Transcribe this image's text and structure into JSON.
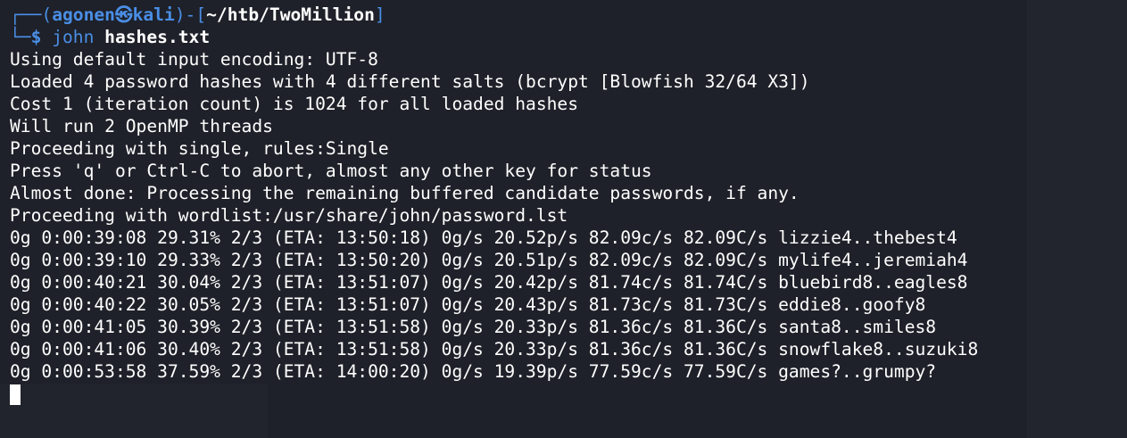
{
  "prompt": {
    "open": "┌──(",
    "user": "agonen",
    "skull": "㉿",
    "host": "kali",
    "mid": ")-[",
    "path": "~/htb/TwoMillion",
    "close": "]",
    "second_line_prefix": "└─",
    "dollar": "$",
    "command": "john",
    "argument": "hashes.txt"
  },
  "output_lines": [
    "Using default input encoding: UTF-8",
    "Loaded 4 password hashes with 4 different salts (bcrypt [Blowfish 32/64 X3])",
    "Cost 1 (iteration count) is 1024 for all loaded hashes",
    "Will run 2 OpenMP threads",
    "Proceeding with single, rules:Single",
    "Press 'q' or Ctrl-C to abort, almost any other key for status",
    "Almost done: Processing the remaining buffered candidate passwords, if any.",
    "Proceeding with wordlist:/usr/share/john/password.lst",
    "0g 0:00:39:08 29.31% 2/3 (ETA: 13:50:18) 0g/s 20.52p/s 82.09c/s 82.09C/s lizzie4..thebest4",
    "0g 0:00:39:10 29.33% 2/3 (ETA: 13:50:20) 0g/s 20.51p/s 82.09c/s 82.09C/s mylife4..jeremiah4",
    "0g 0:00:40:21 30.04% 2/3 (ETA: 13:51:07) 0g/s 20.42p/s 81.74c/s 81.74C/s bluebird8..eagles8",
    "0g 0:00:40:22 30.05% 2/3 (ETA: 13:51:07) 0g/s 20.43p/s 81.73c/s 81.73C/s eddie8..goofy8",
    "0g 0:00:41:05 30.39% 2/3 (ETA: 13:51:58) 0g/s 20.33p/s 81.36c/s 81.36C/s santa8..smiles8",
    "0g 0:00:41:06 30.40% 2/3 (ETA: 13:51:58) 0g/s 20.33p/s 81.36c/s 81.36C/s snowflake8..suzuki8",
    "0g 0:00:53:58 37.59% 2/3 (ETA: 14:00:20) 0g/s 19.39p/s 77.59c/s 77.59C/s games?..grumpy?"
  ],
  "colors": {
    "background": "#1e2129",
    "prompt_blue": "#4a8ee6",
    "text": "#ffffff"
  }
}
